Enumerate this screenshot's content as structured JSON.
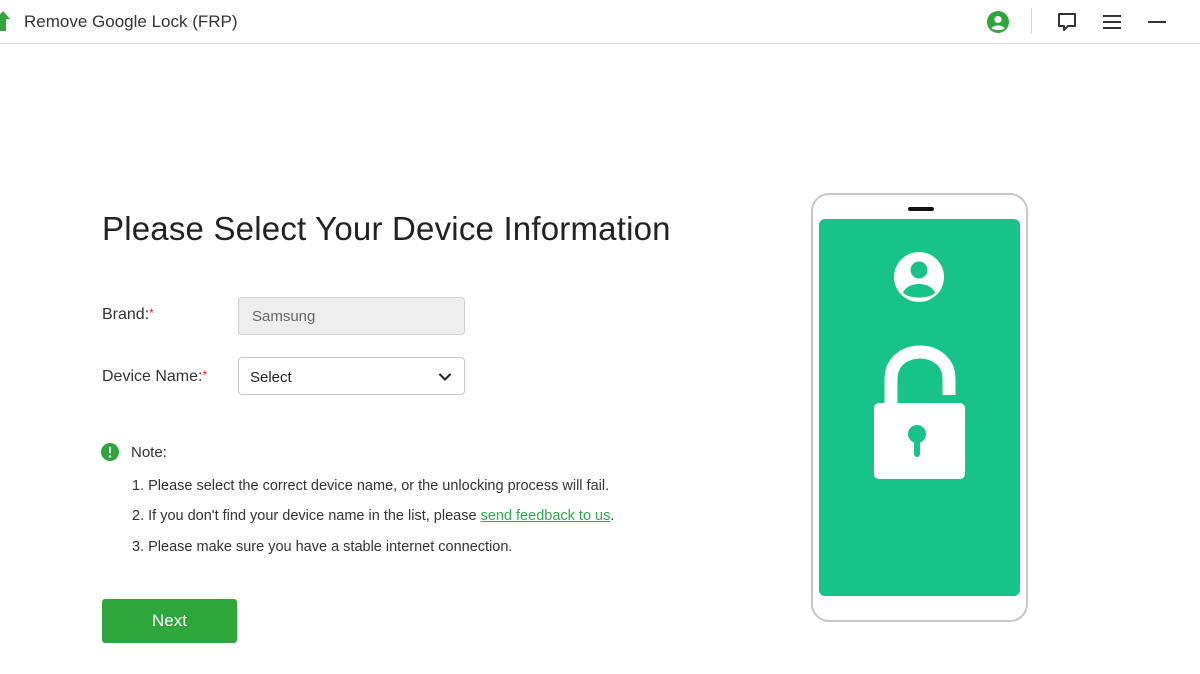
{
  "window": {
    "title": "Remove Google Lock (FRP)"
  },
  "toolbar": {
    "icons": [
      "account-icon",
      "feedback-icon",
      "menu-icon",
      "minimize-icon"
    ]
  },
  "main": {
    "heading": "Please Select Your Device Information",
    "brand": {
      "label": "Brand:",
      "required_mark": "*",
      "value": "Samsung"
    },
    "device": {
      "label": "Device Name:",
      "required_mark": "*",
      "selected": "Select"
    },
    "note": {
      "title": "Note:",
      "line1": "1. Please select the correct device name, or the unlocking process will fail.",
      "line2_prefix": "2. If you don't find your device name in the list, please ",
      "line2_link": "send feedback to us",
      "line2_suffix": ".",
      "line3": "3. Please make sure you have a stable internet connection."
    },
    "next_label": "Next"
  },
  "colors": {
    "accent": "#2fa63c",
    "phone_screen": "#17c389",
    "link": "#2fa84f",
    "required": "#e02020"
  }
}
